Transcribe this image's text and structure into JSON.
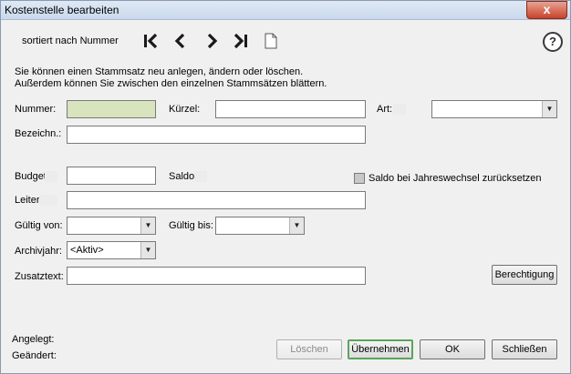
{
  "window": {
    "title": "Kostenstelle bearbeiten",
    "close_label": "x"
  },
  "toolbar": {
    "sort_label": "sortiert nach Nummer",
    "help_label": "?"
  },
  "info": {
    "line1": "Sie können einen Stammsatz neu anlegen, ändern oder löschen.",
    "line2": "Außerdem können Sie zwischen den einzelnen Stammsätzen blättern."
  },
  "form": {
    "nummer_label": "Nummer:",
    "nummer_value": "",
    "kuerzel_label": "Kürzel:",
    "kuerzel_value": "",
    "art_label": "Art:",
    "art_value": "",
    "bezeichn_label": "Bezeichn.:",
    "bezeichn_value": "",
    "budget_label": "Budget:",
    "budget_value": "",
    "saldo_label": "Saldo:",
    "saldo_reset_label": "Saldo bei Jahreswechsel zurücksetzen",
    "leiter_label": "Leiter:",
    "leiter_value": "",
    "gueltig_von_label": "Gültig von:",
    "gueltig_von_value": "",
    "gueltig_bis_label": "Gültig bis:",
    "gueltig_bis_value": "",
    "archivjahr_label": "Archivjahr:",
    "archivjahr_value": "<Aktiv>",
    "zusatztext_label": "Zusatztext:",
    "zusatztext_value": ""
  },
  "footer": {
    "angelegt_label": "Angelegt:",
    "geaendert_label": "Geändert:"
  },
  "buttons": {
    "berechtigung": "Berechtigung",
    "loeschen": "Löschen",
    "uebernehmen": "Übernehmen",
    "ok": "OK",
    "schliessen": "Schließen"
  }
}
